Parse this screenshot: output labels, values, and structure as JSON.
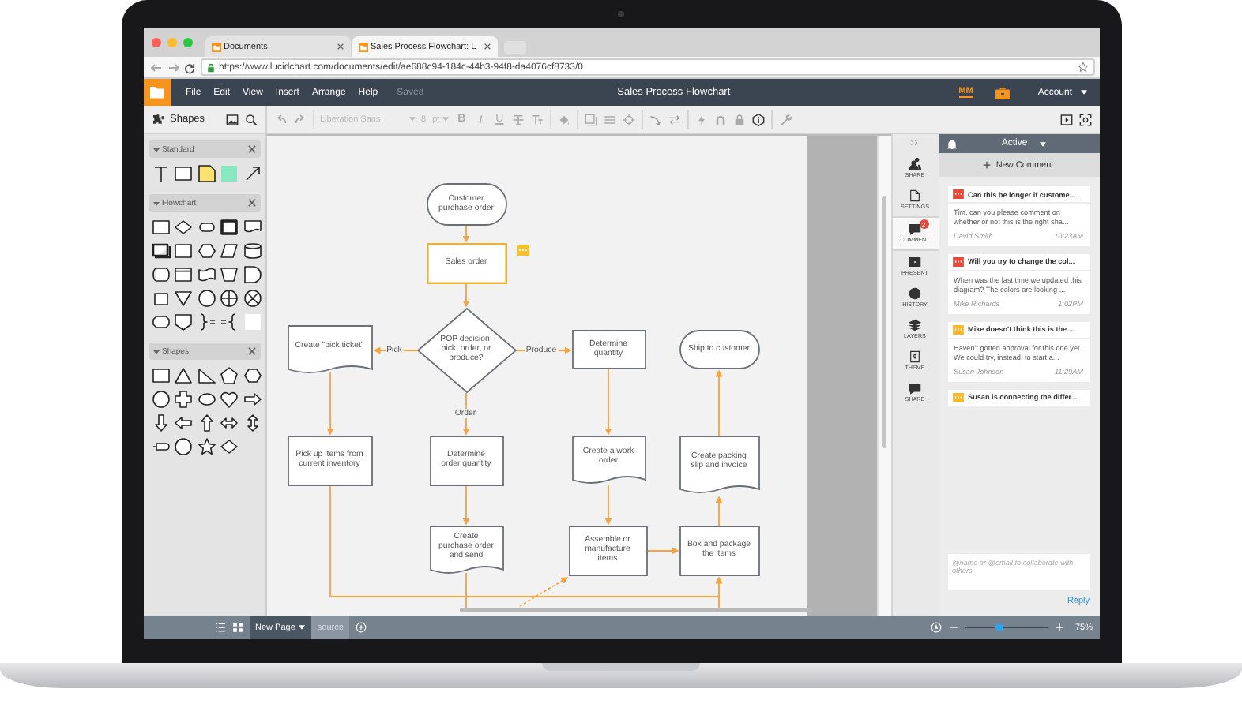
{
  "browser": {
    "tabs": [
      {
        "label": "Documents",
        "selected": false
      },
      {
        "label": "Sales Process Flowchart: L",
        "selected": true
      }
    ],
    "url": "https://www.lucidchart.com/documents/edit/ae688c94-184c-44b3-94f8-da4076cf8733/0"
  },
  "menu_bar": {
    "items": [
      "File",
      "Edit",
      "View",
      "Insert",
      "Arrange",
      "Help"
    ],
    "save_status": "Saved",
    "title": "Sales Process Flowchart",
    "user_initials": "MM",
    "account": "Account"
  },
  "toolbar": {
    "shapes_label": "Shapes",
    "font": "Liberation Sans",
    "font_size": "8",
    "font_unit": "pt",
    "format_buttons": [
      "B",
      "I",
      "U"
    ]
  },
  "shape_library": {
    "sections": [
      {
        "title": "Standard",
        "expanded": true
      },
      {
        "title": "Flowchart",
        "expanded": true
      },
      {
        "title": "Shapes",
        "expanded": true
      }
    ]
  },
  "diagram": {
    "nodes": [
      {
        "kind": "terminal",
        "text": "Customer purchase order",
        "selected": false,
        "commented": false
      },
      {
        "kind": "process",
        "text": "Sales order",
        "selected": true,
        "commented": true
      },
      {
        "kind": "document",
        "text": "Create \"pick ticket\"",
        "selected": false,
        "commented": false
      },
      {
        "kind": "decision",
        "text": "POP decision: pick, order, or produce?",
        "selected": false,
        "commented": false
      },
      {
        "kind": "process",
        "text": "Determine quantity",
        "selected": false,
        "commented": false
      },
      {
        "kind": "terminal",
        "text": "Ship to customer",
        "selected": false,
        "commented": false
      },
      {
        "kind": "process",
        "text": "Pick up items from current inventory",
        "selected": false,
        "commented": false
      },
      {
        "kind": "process",
        "text": "Determine order quantity",
        "selected": false,
        "commented": false
      },
      {
        "kind": "document",
        "text": "Create a work order",
        "selected": false,
        "commented": false
      },
      {
        "kind": "document",
        "text": "Create packing slip and invoice",
        "selected": false,
        "commented": false
      },
      {
        "kind": "document",
        "text": "Create purchase order and send",
        "selected": false,
        "commented": false
      },
      {
        "kind": "process",
        "text": "Assemble or manufacture items",
        "selected": false,
        "commented": false
      },
      {
        "kind": "process",
        "text": "Box and package the items",
        "selected": false,
        "commented": false
      }
    ],
    "edge_labels": [
      "Pick",
      "Produce",
      "Order"
    ]
  },
  "side_tabs": [
    {
      "label": "SHARE",
      "selected": false
    },
    {
      "label": "SETTINGS",
      "selected": false
    },
    {
      "label": "COMMENT",
      "selected": true,
      "badge": "2"
    },
    {
      "label": "PRESENT",
      "selected": false
    },
    {
      "label": "HISTORY",
      "selected": false
    },
    {
      "label": "LAYERS",
      "selected": false
    },
    {
      "label": "THEME",
      "selected": false
    },
    {
      "label": "SHARE",
      "selected": false
    }
  ],
  "comments_panel": {
    "filter": "Active",
    "new_comment": "New Comment",
    "comments": [
      {
        "title": "Can this be longer if custome...",
        "body": "Tim, can you please comment on whether or not this is the right sha...",
        "author": "David Smith",
        "time": "10:23AM",
        "color": "#e5493a"
      },
      {
        "title": "Will you try to change the col...",
        "body": "When was the last time we updated this diagram? The colors are looking ...",
        "author": "Mike Richards",
        "time": "1:02PM",
        "color": "#e5493a"
      },
      {
        "title": "Mike doesn't think this is the ...",
        "body": "Haven't gotten approval for this one yet. We could try, instead, to start a...",
        "author": "Susan Johnson",
        "time": "11:29AM",
        "color": "#f5b82e"
      },
      {
        "title": "Susan is connecting the differ...",
        "color": "#f5b82e"
      }
    ],
    "reply_placeholder": "@name or @email to collaborate with others",
    "reply": "Reply"
  },
  "bottom_bar": {
    "page_tab": "New Page",
    "source_tab": "source",
    "zoom": {
      "level": 0.4
    },
    "zoom_label": "75%"
  }
}
